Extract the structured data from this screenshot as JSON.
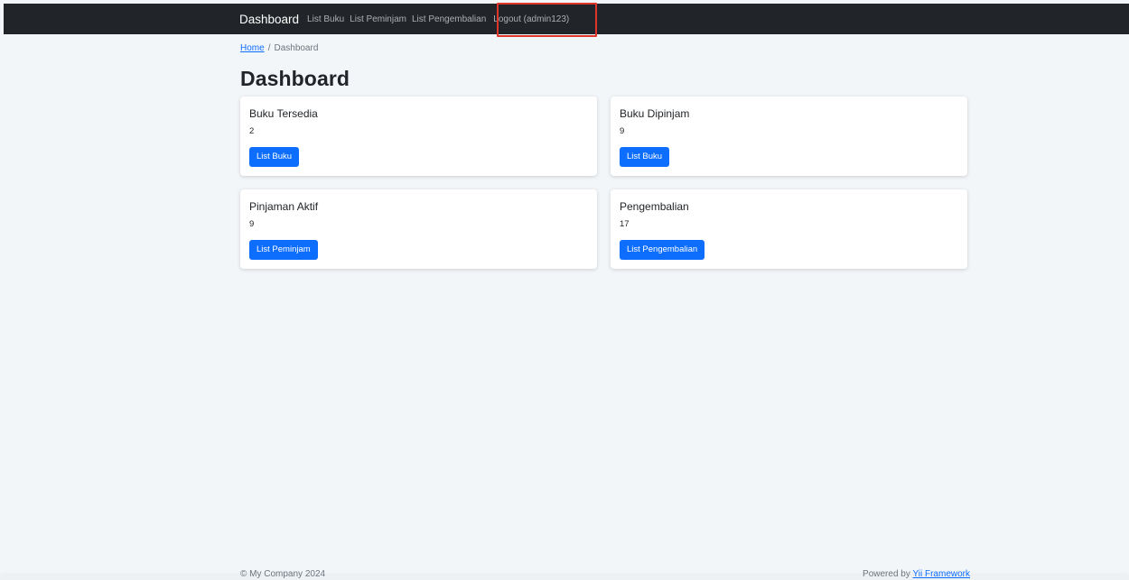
{
  "navbar": {
    "brand": "Dashboard",
    "links": [
      "List Buku",
      "List Peminjam",
      "List Pengembalian"
    ],
    "logout": "Logout (admin123)"
  },
  "breadcrumb": {
    "home": "Home",
    "separator": "/",
    "current": "Dashboard"
  },
  "page": {
    "title": "Dashboard"
  },
  "cards": [
    {
      "title": "Buku Tersedia",
      "value": "2",
      "button": "List Buku"
    },
    {
      "title": "Buku Dipinjam",
      "value": "9",
      "button": "List Buku"
    },
    {
      "title": "Pinjaman Aktif",
      "value": "9",
      "button": "List Peminjam"
    },
    {
      "title": "Pengembalian",
      "value": "17",
      "button": "List Pengembalian"
    }
  ],
  "footer": {
    "copyright": "© My Company 2024",
    "powered_prefix": "Powered by",
    "powered_link": "Yii Framework"
  },
  "colors": {
    "navbar_bg": "#212529",
    "page_bg": "#f3f6f9",
    "primary": "#0d6efd",
    "highlight": "#e0352b"
  }
}
